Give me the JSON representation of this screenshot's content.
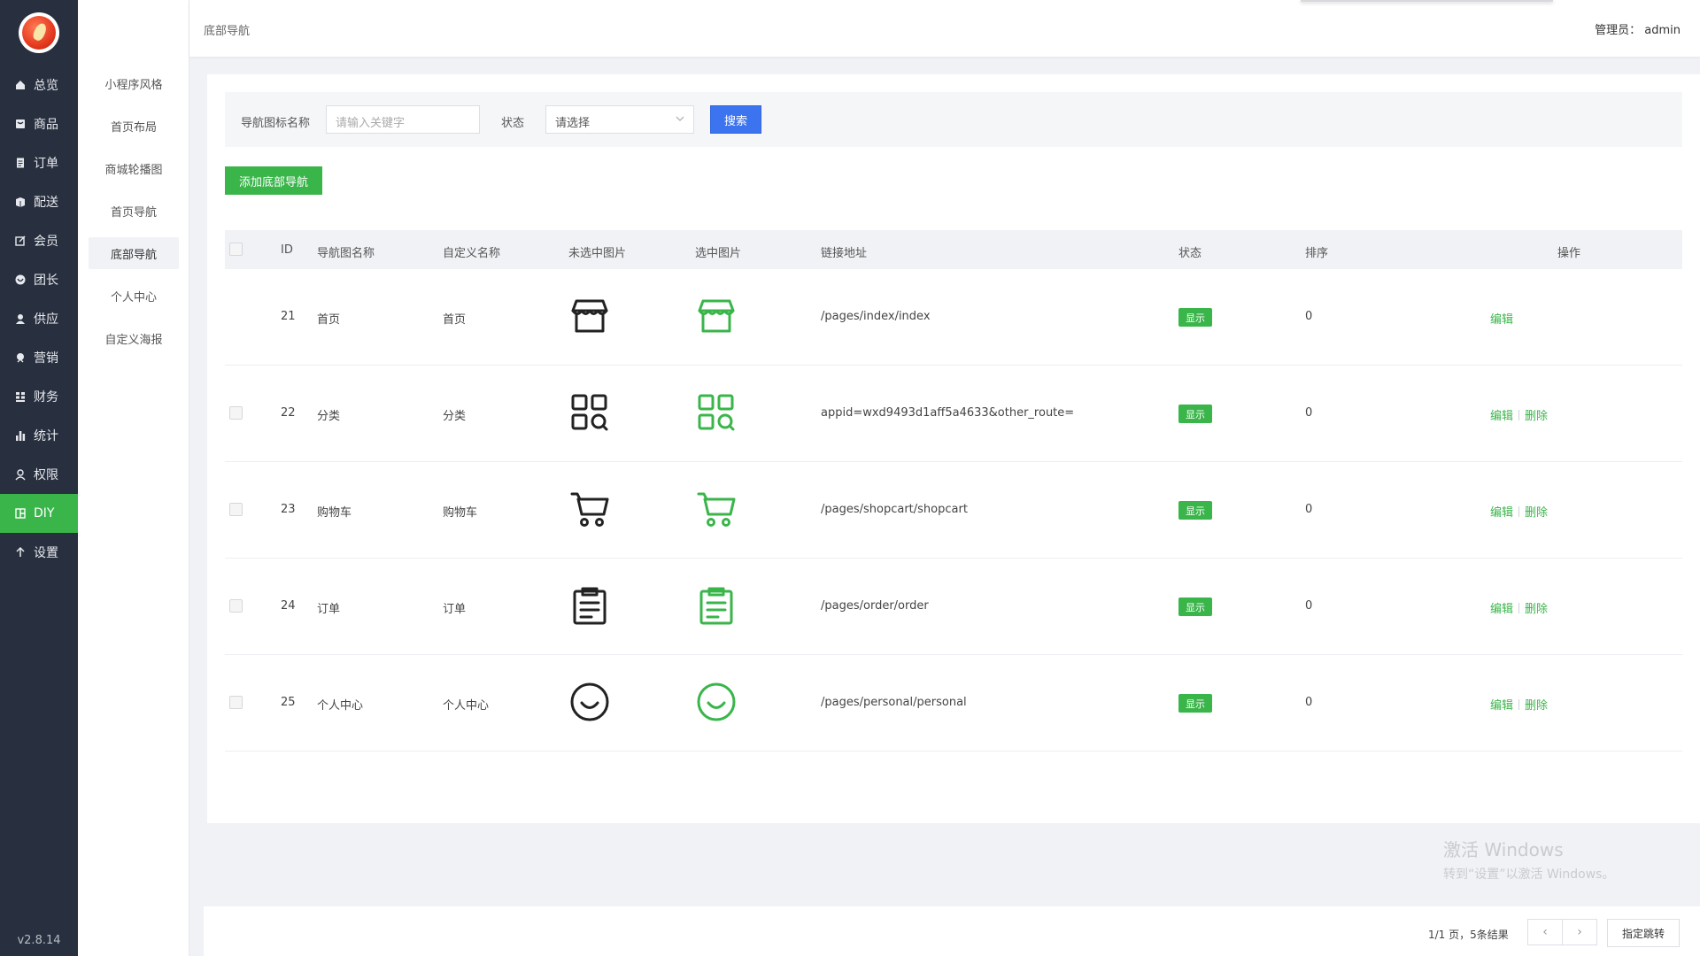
{
  "sidebar": {
    "items": [
      {
        "label": "总览",
        "icon": "home-icon"
      },
      {
        "label": "商品",
        "icon": "goods-icon"
      },
      {
        "label": "订单",
        "icon": "order-icon"
      },
      {
        "label": "配送",
        "icon": "delivery-icon"
      },
      {
        "label": "会员",
        "icon": "member-icon"
      },
      {
        "label": "团长",
        "icon": "leader-icon"
      },
      {
        "label": "供应",
        "icon": "supply-icon"
      },
      {
        "label": "营销",
        "icon": "marketing-icon"
      },
      {
        "label": "财务",
        "icon": "finance-icon"
      },
      {
        "label": "统计",
        "icon": "stats-icon"
      },
      {
        "label": "权限",
        "icon": "permission-icon"
      },
      {
        "label": "DIY",
        "icon": "diy-icon"
      },
      {
        "label": "设置",
        "icon": "settings-icon"
      }
    ],
    "active_index": 11,
    "version": "v2.8.14",
    "active_color": "#3ab54a"
  },
  "submenu": {
    "items": [
      "小程序风格",
      "首页布局",
      "商城轮播图",
      "首页导航",
      "底部导航",
      "个人中心",
      "自定义海报"
    ],
    "active_index": 4
  },
  "header": {
    "breadcrumb": "底部导航",
    "admin": "管理员： admin"
  },
  "filter": {
    "name_label": "导航图标名称",
    "name_placeholder": "请输入关键字",
    "status_label": "状态",
    "status_value": "请选择",
    "search_label": "搜索"
  },
  "add_button": "添加底部导航",
  "table": {
    "headers": [
      "ID",
      "导航图名称",
      "自定义名称",
      "未选中图片",
      "选中图片",
      "链接地址",
      "状态",
      "排序",
      "操作"
    ],
    "rows": [
      {
        "id": "21",
        "name": "首页",
        "custom": "首页",
        "icon": "shop-icon",
        "link": "/pages/index/index",
        "status": "显示",
        "sort": "0",
        "edit": "编辑",
        "delete": ""
      },
      {
        "id": "22",
        "name": "分类",
        "custom": "分类",
        "icon": "category-icon",
        "link": "appid=wxd9493d1aff5a4633&other_route=",
        "status": "显示",
        "sort": "0",
        "edit": "编辑",
        "delete": "删除"
      },
      {
        "id": "23",
        "name": "购物车",
        "custom": "购物车",
        "icon": "cart-icon",
        "link": "/pages/shopcart/shopcart",
        "status": "显示",
        "sort": "0",
        "edit": "编辑",
        "delete": "删除"
      },
      {
        "id": "24",
        "name": "订单",
        "custom": "订单",
        "icon": "clipboard-icon",
        "link": "/pages/order/order",
        "status": "显示",
        "sort": "0",
        "edit": "编辑",
        "delete": "删除"
      },
      {
        "id": "25",
        "name": "个人中心",
        "custom": "个人中心",
        "icon": "smile-icon",
        "link": "/pages/personal/personal",
        "status": "显示",
        "sort": "0",
        "edit": "编辑",
        "delete": "删除"
      }
    ]
  },
  "pagination": {
    "info": "1/1 页，5条结果",
    "prev": "‹",
    "next": "›",
    "jump": "指定跳转"
  },
  "watermark": {
    "line1": "激活 Windows",
    "line2": "转到“设置”以激活 Windows。"
  },
  "colors": {
    "unselected_icon": "#222222",
    "selected_icon": "#3ab54a",
    "primary_blue": "#3c74f0"
  }
}
